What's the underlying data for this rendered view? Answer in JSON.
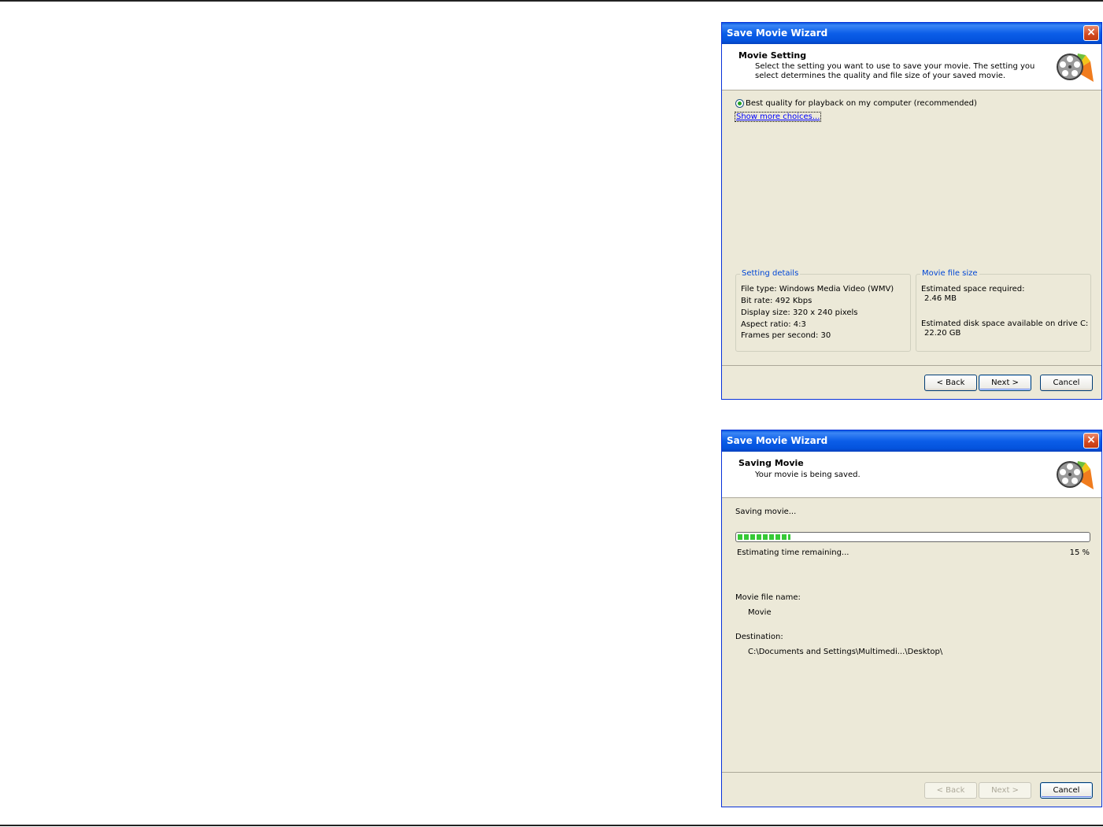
{
  "wizard1": {
    "title": "Save Movie Wizard",
    "close_label": "×",
    "header_title": "Movie Setting",
    "header_subtitle": "Select the setting you want to use to save your movie. The setting you select determines the quality and file size of your saved movie.",
    "radio_option": "Best quality for playback on my computer (recommended)",
    "more_choices_link": "Show more choices...",
    "setting_details": {
      "title": "Setting details",
      "lines": [
        "File type: Windows Media Video (WMV)",
        "Bit rate: 492 Kbps",
        "Display size: 320 x 240 pixels",
        "Aspect ratio: 4:3",
        "Frames per second: 30"
      ]
    },
    "file_size": {
      "title": "Movie file size",
      "required_label": "Estimated space required:",
      "required_value": "2.46 MB",
      "available_label": "Estimated disk space available on drive C:",
      "available_value": "22.20 GB"
    },
    "buttons": {
      "back": "< Back",
      "next": "Next >",
      "cancel": "Cancel"
    }
  },
  "wizard2": {
    "title": "Save Movie Wizard",
    "close_label": "×",
    "header_title": "Saving Movie",
    "header_subtitle": "Your movie is being saved.",
    "status_text": "Saving movie...",
    "progress_percent": 15,
    "time_remaining": "Estimating time remaining...",
    "percent_label": "15 %",
    "file_name_label": "Movie file name:",
    "file_name_value": "Movie",
    "destination_label": "Destination:",
    "destination_value": "C:\\Documents and Settings\\Multimedi...\\Desktop\\",
    "buttons": {
      "back": "< Back",
      "next": "Next >",
      "cancel": "Cancel"
    }
  },
  "colors": {
    "titlebar": "#0b5de8",
    "dialog_bg": "#ece9d8",
    "progress": "#36c936",
    "link": "#0000ff",
    "group_title": "#0046d5"
  },
  "icons": [
    "close-icon",
    "movie-maker-icon",
    "radio-selected-icon"
  ]
}
